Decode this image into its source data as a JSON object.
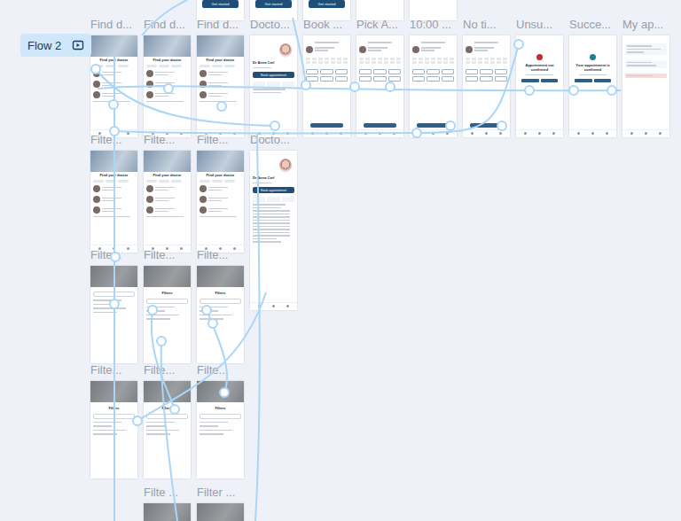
{
  "flow": {
    "label": "Flow 2"
  },
  "top_frames": [
    {
      "kind": "start",
      "button": "Get started"
    },
    {
      "kind": "start",
      "button": "Get started"
    },
    {
      "kind": "start",
      "button": "Get started"
    },
    {
      "kind": "blank"
    },
    {
      "kind": "blank"
    }
  ],
  "rows": [
    {
      "frames": [
        {
          "label": "Find d...",
          "kind": "find",
          "title": "Find your doctor"
        },
        {
          "label": "Find d...",
          "kind": "find",
          "title": "Find your doctor"
        },
        {
          "label": "Find d...",
          "kind": "find",
          "title": "Find your doctor"
        },
        {
          "label": "Docto...",
          "kind": "profile",
          "title": "Dr Anna Carl",
          "button": "Book appointment"
        },
        {
          "label": "Book ...",
          "kind": "calendar"
        },
        {
          "label": "Pick A...",
          "kind": "calendar"
        },
        {
          "label": "10:00 ...",
          "kind": "calendar"
        },
        {
          "label": "No ti...",
          "kind": "calendar"
        },
        {
          "label": "Unsu...",
          "kind": "status",
          "title": "Appointment not confirmed",
          "color": "#c62828"
        },
        {
          "label": "Succe...",
          "kind": "status",
          "title": "Your appointment is confirmed",
          "color": "#1e7f8f"
        },
        {
          "label": "My ap...",
          "kind": "list"
        }
      ]
    },
    {
      "frames": [
        {
          "label": "Filte...",
          "kind": "find",
          "title": "Find your doctor"
        },
        {
          "label": "Filte...",
          "kind": "find",
          "title": "Find your doctor"
        },
        {
          "label": "Filte...",
          "kind": "find",
          "title": "Find your doctor"
        },
        {
          "label": "Docto...",
          "kind": "details",
          "title": "Dr Anna Carl",
          "button": "Book appointment"
        }
      ]
    },
    {
      "frames": [
        {
          "label": "Filte...",
          "kind": "filters",
          "title": ""
        },
        {
          "label": "Filte...",
          "kind": "filters",
          "title": "Filters"
        },
        {
          "label": "Filte...",
          "kind": "filters",
          "title": "Filters"
        }
      ]
    },
    {
      "frames": [
        {
          "label": "Filte...",
          "kind": "filters",
          "title": "Filters"
        },
        {
          "label": "Filte...",
          "kind": "filters",
          "title": "Filters"
        },
        {
          "label": "Filte...",
          "kind": "filters",
          "title": "Filters"
        }
      ]
    },
    {
      "frames": [
        {
          "label": "Filte ...",
          "kind": "filters",
          "title": ""
        },
        {
          "label": "Filter ...",
          "kind": "filters",
          "title": ""
        }
      ]
    }
  ]
}
